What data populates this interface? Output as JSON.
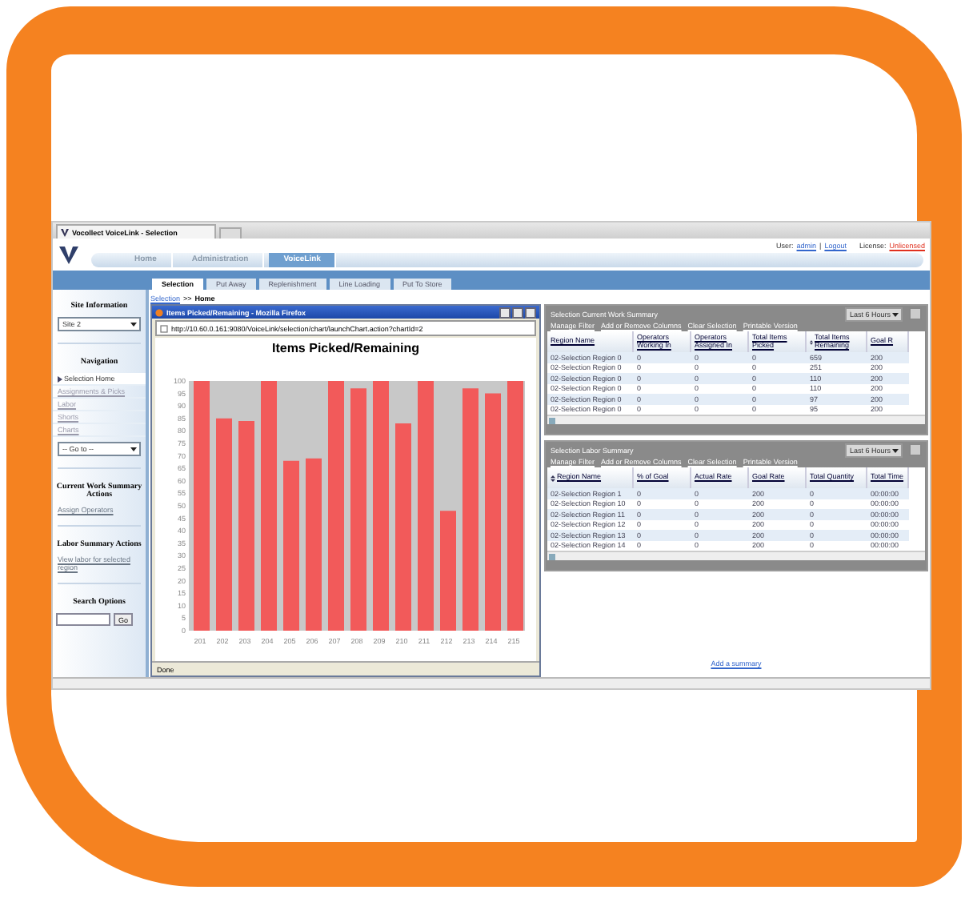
{
  "browser": {
    "tab_title": "Vocollect VoiceLink - Selection"
  },
  "header": {
    "nav_tabs": [
      {
        "label": "Home",
        "selected": false
      },
      {
        "label": "Administration",
        "selected": false
      },
      {
        "label": "VoiceLink",
        "selected": true
      }
    ],
    "user_label": "User:",
    "user_name": "admin",
    "separator": "|",
    "logout": "Logout",
    "license_label": "License:",
    "license_value": "Unlicensed"
  },
  "sub_tabs": [
    {
      "label": "Selection",
      "selected": true
    },
    {
      "label": "Put Away",
      "selected": false
    },
    {
      "label": "Replenishment",
      "selected": false
    },
    {
      "label": "Line Loading",
      "selected": false
    },
    {
      "label": "Put To Store",
      "selected": false
    }
  ],
  "sidebar": {
    "site_heading": "Site Information",
    "site_value": "Site 2",
    "nav_heading": "Navigation",
    "nav_items": [
      {
        "label": "Selection Home",
        "selected": true
      },
      {
        "label": "Assignments & Picks",
        "selected": false
      },
      {
        "label": "Labor",
        "selected": false
      },
      {
        "label": "Shorts",
        "selected": false
      },
      {
        "label": "Charts",
        "selected": false
      }
    ],
    "goto_value": "-- Go to --",
    "sections": [
      {
        "heading": "Current Work Summary Actions",
        "action": "Assign Operators"
      },
      {
        "heading": "Labor Summary Actions",
        "action": "View labor for selected region"
      }
    ],
    "search_heading": "Search Options",
    "search_button": "Go"
  },
  "breadcrumb": {
    "link": "Selection",
    "separator": ">>",
    "current": "Home"
  },
  "popup": {
    "title": "Items Picked/Remaining - Mozilla Firefox",
    "url": "http://10.60.0.161:9080/VoiceLink/selection/chart/launchChart.action?chartId=2",
    "status": "Done",
    "chart_data": {
      "type": "bar",
      "title": "Items Picked/Remaining",
      "categories": [
        "201",
        "202",
        "203",
        "204",
        "205",
        "206",
        "207",
        "208",
        "209",
        "210",
        "211",
        "212",
        "213",
        "214",
        "215"
      ],
      "series": [
        {
          "color": "#f25a5a",
          "values": [
            100,
            85,
            84,
            100,
            68,
            69,
            100,
            97,
            100,
            83,
            100,
            48,
            97,
            95,
            100
          ]
        }
      ],
      "ylim": [
        0,
        100
      ],
      "yticks": [
        0,
        5,
        10,
        15,
        20,
        25,
        30,
        35,
        40,
        45,
        50,
        55,
        60,
        65,
        70,
        75,
        80,
        85,
        90,
        95,
        100
      ]
    }
  },
  "panels": [
    {
      "title": "Selection Current Work Summary",
      "time_filter": "Last 6 Hours",
      "links": [
        "Manage Filter",
        "Add or Remove Columns",
        "Clear Selection",
        "Printable Version"
      ],
      "columns": [
        {
          "label": "Region Name",
          "sorted": false
        },
        {
          "label": "Operators Working In",
          "sorted": false
        },
        {
          "label": "Operators Assigned In",
          "sorted": false
        },
        {
          "label": "Total Items Picked",
          "sorted": false
        },
        {
          "label": "Total Items Remaining",
          "sorted": true
        },
        {
          "label": "Goal R",
          "sorted": false
        }
      ],
      "rows": [
        [
          "02-Selection Region 0",
          "0",
          "0",
          "0",
          "659",
          "200"
        ],
        [
          "02-Selection Region 0",
          "0",
          "0",
          "0",
          "251",
          "200"
        ],
        [
          "02-Selection Region 0",
          "0",
          "0",
          "0",
          "110",
          "200"
        ],
        [
          "02-Selection Region 0",
          "0",
          "0",
          "0",
          "110",
          "200"
        ],
        [
          "02-Selection Region 0",
          "0",
          "0",
          "0",
          "97",
          "200"
        ],
        [
          "02-Selection Region 0",
          "0",
          "0",
          "0",
          "95",
          "200"
        ]
      ]
    },
    {
      "title": "Selection Labor Summary",
      "time_filter": "Last 6 Hours",
      "links": [
        "Manage Filter",
        "Add or Remove Columns",
        "Clear Selection",
        "Printable Version"
      ],
      "columns": [
        {
          "label": "Region Name",
          "sorted": true
        },
        {
          "label": "% of Goal",
          "sorted": false
        },
        {
          "label": "Actual Rate",
          "sorted": false
        },
        {
          "label": "Goal Rate",
          "sorted": false
        },
        {
          "label": "Total Quantity",
          "sorted": false
        },
        {
          "label": "Total Time",
          "sorted": false
        }
      ],
      "rows": [
        [
          "02-Selection Region 1",
          "0",
          "0",
          "200",
          "0",
          "00:00:00"
        ],
        [
          "02-Selection Region 10",
          "0",
          "0",
          "200",
          "0",
          "00:00:00"
        ],
        [
          "02-Selection Region 11",
          "0",
          "0",
          "200",
          "0",
          "00:00:00"
        ],
        [
          "02-Selection Region 12",
          "0",
          "0",
          "200",
          "0",
          "00:00:00"
        ],
        [
          "02-Selection Region 13",
          "0",
          "0",
          "200",
          "0",
          "00:00:00"
        ],
        [
          "02-Selection Region 14",
          "0",
          "0",
          "200",
          "0",
          "00:00:00"
        ]
      ]
    }
  ],
  "add_summary": "Add a summary"
}
